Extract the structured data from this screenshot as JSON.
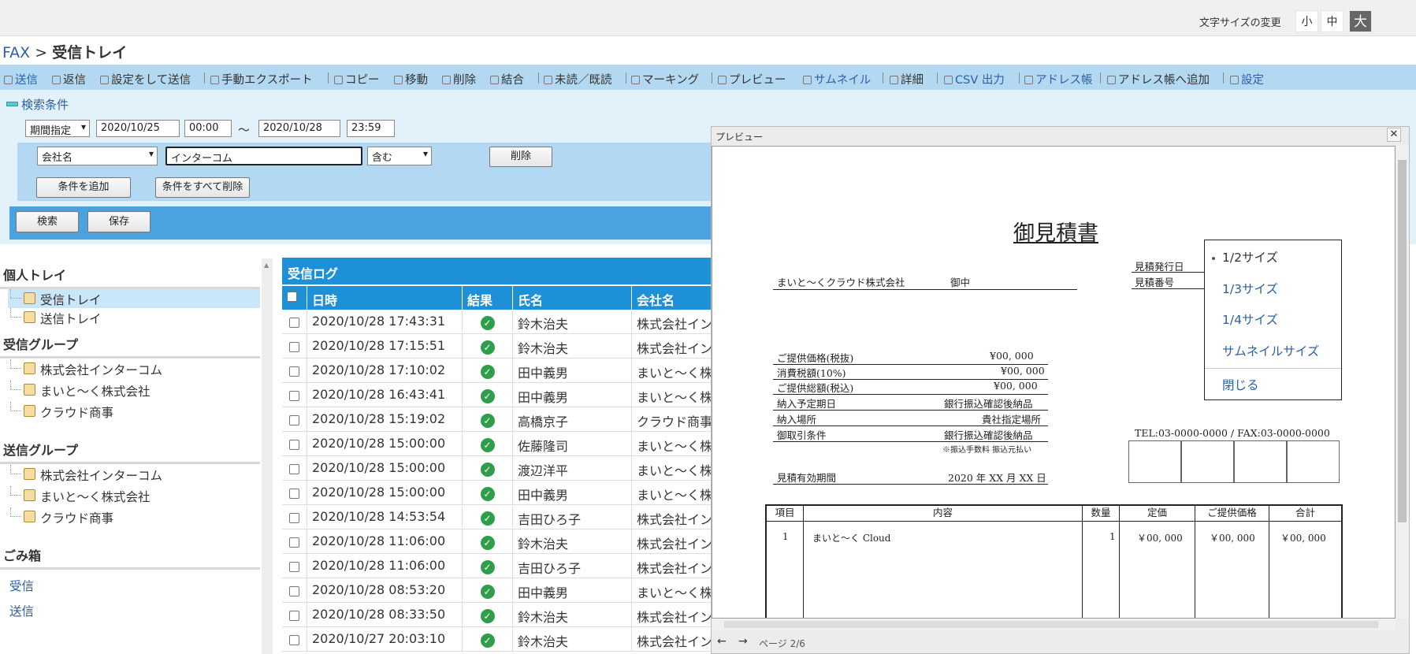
{
  "font_size": {
    "label": "文字サイズの変更",
    "options": [
      "小",
      "中",
      "大"
    ],
    "selected": "大"
  },
  "breadcrumb": {
    "root": "FAX",
    "separator": ">",
    "current": "受信トレイ"
  },
  "toolbar": {
    "items": [
      {
        "label": "送信",
        "icon": "printer-icon",
        "blue": true
      },
      {
        "label": "返信",
        "icon": "printer-icon",
        "blue": false
      },
      {
        "label": "設定をして送信",
        "icon": "printer-icon",
        "blue": false
      },
      {
        "label": "手動エクスポート",
        "icon": "export-icon",
        "blue": false
      },
      {
        "label": "コピー",
        "icon": "copy-icon",
        "blue": false
      },
      {
        "label": "移動",
        "icon": "move-icon",
        "blue": false
      },
      {
        "label": "削除",
        "icon": "trash-icon",
        "blue": false
      },
      {
        "label": "結合",
        "icon": "merge-icon",
        "blue": false
      },
      {
        "label": "未読／既読",
        "icon": "filter-icon",
        "blue": false
      },
      {
        "label": "マーキング",
        "icon": "marker-icon",
        "blue": false
      },
      {
        "label": "プレビュー",
        "icon": "preview-icon",
        "blue": false
      },
      {
        "label": "サムネイル",
        "icon": "thumbnail-icon",
        "blue": true
      },
      {
        "label": "詳細",
        "icon": "detail-icon",
        "blue": false
      },
      {
        "label": "CSV 出力",
        "icon": "arrow-up-icon",
        "blue": true
      },
      {
        "label": "アドレス帳",
        "icon": "addressbook-icon",
        "blue": true
      },
      {
        "label": "アドレス帳へ追加",
        "icon": "addressbook-icon",
        "blue": false
      },
      {
        "label": "設定",
        "icon": "wrench-icon",
        "blue": true
      }
    ]
  },
  "search": {
    "title": "検索条件",
    "period_type": "期間指定",
    "date_from": "2020/10/25",
    "time_from": "00:00",
    "range_sep": "〜",
    "date_to": "2020/10/28",
    "time_to": "23:59",
    "field": "会社名",
    "keyword": "インターコム",
    "match": "含む",
    "delete_label": "削除",
    "add_condition_label": "条件を追加",
    "clear_conditions_label": "条件をすべて削除",
    "search_label": "検索",
    "save_label": "保存"
  },
  "sidebar": {
    "personal_heading": "個人トレイ",
    "personal_items": [
      "受信トレイ",
      "送信トレイ"
    ],
    "recv_group_heading": "受信グループ",
    "recv_group_items": [
      "株式会社インターコム",
      "まいと〜く株式会社",
      "クラウド商事"
    ],
    "send_group_heading": "送信グループ",
    "send_group_items": [
      "株式会社インターコム",
      "まいと〜く株式会社",
      "クラウド商事"
    ],
    "trash_heading": "ごみ箱",
    "trash_items": [
      "受信",
      "送信"
    ]
  },
  "log": {
    "title": "受信ログ",
    "columns": [
      "日時",
      "結果",
      "氏名",
      "会社名"
    ],
    "rows": [
      {
        "datetime": "2020/10/28 17:43:31",
        "name": "鈴木治夫",
        "company": "株式会社インターコム"
      },
      {
        "datetime": "2020/10/28 17:15:51",
        "name": "鈴木治夫",
        "company": "株式会社インターコム"
      },
      {
        "datetime": "2020/10/28 17:10:02",
        "name": "田中義男",
        "company": "まいと〜く株式会社"
      },
      {
        "datetime": "2020/10/28 16:43:41",
        "name": "田中義男",
        "company": "まいと〜く株式会社"
      },
      {
        "datetime": "2020/10/28 15:19:02",
        "name": "高橋京子",
        "company": "クラウド商事"
      },
      {
        "datetime": "2020/10/28 15:00:00",
        "name": "佐藤隆司",
        "company": "まいと〜く株式会社"
      },
      {
        "datetime": "2020/10/28 15:00:00",
        "name": "渡辺洋平",
        "company": "まいと〜く株式会社"
      },
      {
        "datetime": "2020/10/28 15:00:00",
        "name": "田中義男",
        "company": "まいと〜く株式会社"
      },
      {
        "datetime": "2020/10/28 14:53:54",
        "name": "吉田ひろ子",
        "company": "株式会社インターコム"
      },
      {
        "datetime": "2020/10/28 11:06:00",
        "name": "鈴木治夫",
        "company": "株式会社インターコム"
      },
      {
        "datetime": "2020/10/28 11:06:00",
        "name": "吉田ひろ子",
        "company": "株式会社インターコム"
      },
      {
        "datetime": "2020/10/28 08:53:20",
        "name": "田中義男",
        "company": "まいと〜く株式会社"
      },
      {
        "datetime": "2020/10/28 08:33:50",
        "name": "鈴木治夫",
        "company": "株式会社インターコム"
      },
      {
        "datetime": "2020/10/27 20:03:10",
        "name": "鈴木治夫",
        "company": "株式会社インターコム"
      }
    ]
  },
  "preview": {
    "title": "プレビュー",
    "close": "✕",
    "page_label": "ページ 2/6",
    "nav_prev": "←",
    "nav_next": "→",
    "size_menu": [
      "1/2サイズ",
      "1/3サイズ",
      "1/4サイズ",
      "サムネイルサイズ"
    ],
    "size_selected": "1/2サイズ",
    "close_menu": "閉じる",
    "document": {
      "title": "御見積書",
      "customer": "まいと〜くクラウド株式会社",
      "honorific": "御中",
      "issue_date_label": "見積発行日",
      "number_label": "見積番号",
      "contact": "TEL:03-0000-0000 / FAX:03-0000-0000",
      "summary": [
        {
          "label": "ご提供価格(税抜)",
          "value": "¥00, 000"
        },
        {
          "label": "消費税額(10%)",
          "value": "¥00, 000"
        },
        {
          "label": "ご提供総額(税込)",
          "value": "¥00, 000"
        },
        {
          "label": "納入予定期日",
          "value": "銀行振込確認後納品"
        },
        {
          "label": "納入場所",
          "value": "貴社指定場所"
        },
        {
          "label": "御取引条件",
          "value": "銀行振込確認後納品"
        }
      ],
      "note": "※振込手数料 振込元払い",
      "validity_label": "見積有効期間",
      "validity_value": "2020 年 XX 月 XX 日",
      "table_headers": [
        "項目",
        "内容",
        "数量",
        "定価",
        "ご提供価格",
        "合計"
      ],
      "table_row": [
        "1",
        "まいと〜く Cloud",
        "1",
        "￥00, 000",
        "￥00, 000",
        "￥00, 000"
      ]
    }
  },
  "colors": {
    "accent": "#1e90d8",
    "toolbar": "#b3d9f2",
    "panel": "#e3f1fa",
    "link": "#2b5fa8",
    "ok": "#2e9e4a"
  }
}
